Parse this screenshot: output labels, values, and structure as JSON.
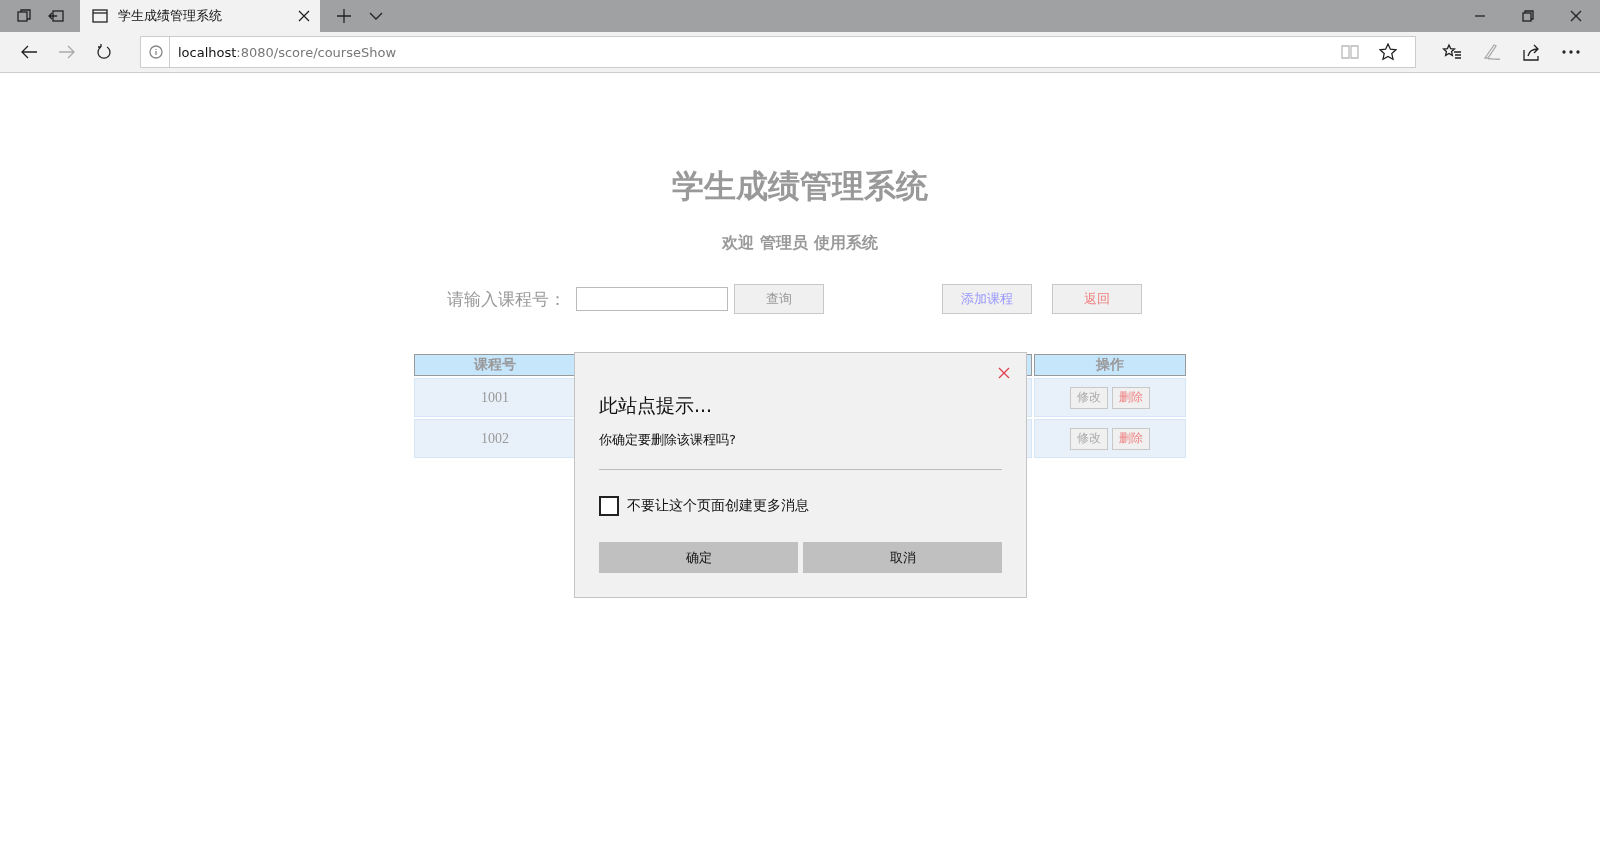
{
  "browser": {
    "tabs": [
      {
        "title": "学生成绩管理系统",
        "selected": true
      }
    ],
    "url": {
      "host": "localhost",
      "path": ":8080/score/courseShow"
    }
  },
  "page": {
    "title": "学生成绩管理系统",
    "welcome": "欢迎 管理员 使用系统",
    "search": {
      "label": "请输入课程号：",
      "button": "查询"
    },
    "actions": [
      {
        "label": "添加课程",
        "kind": "add"
      },
      {
        "label": "返回",
        "kind": "back"
      }
    ],
    "table": {
      "columns": [
        "课程号",
        "操作"
      ],
      "rows": [
        {
          "id": "1001",
          "actions": [
            {
              "label": "修改",
              "kind": "edit"
            },
            {
              "label": "删除",
              "kind": "delete"
            }
          ]
        },
        {
          "id": "1002",
          "actions": [
            {
              "label": "修改",
              "kind": "edit"
            },
            {
              "label": "删除",
              "kind": "delete"
            }
          ]
        }
      ]
    }
  },
  "dialog": {
    "title": "此站点提示...",
    "message": "你确定要删除该课程吗?",
    "checkbox": {
      "label": "不要让这个页面创建更多消息",
      "checked": false
    },
    "buttons": [
      "确定",
      "取消"
    ]
  }
}
